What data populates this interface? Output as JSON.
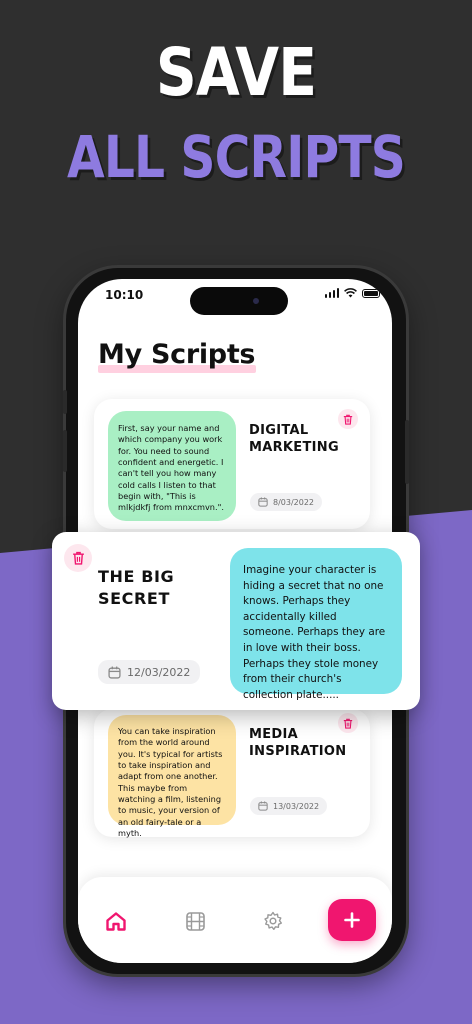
{
  "promo": {
    "line1": "SAVE",
    "line2": "ALL SCRIPTS"
  },
  "status": {
    "time": "10:10"
  },
  "page": {
    "title": "My Scripts"
  },
  "scripts": [
    {
      "title": "DIGITAL MARKETING",
      "date": "8/03/2022",
      "note": "First, say your name and which company you work for. You need to sound confident and energetic. I can't tell you how many cold calls I listen to that begin with, \"This is mlkjdkfj from mnxcmvn.\".",
      "note_color": "#a9efc4"
    },
    {
      "title": "THE BIG SECRET",
      "date": "12/03/2022",
      "note": "Imagine your character is hiding a secret that no one knows. Perhaps they accidentally killed someone. Perhaps they are in love with their boss. Perhaps they stole money from their church's collection plate.....",
      "note_color": "#7ee3ea"
    },
    {
      "title": "MEDIA INSPIRATION",
      "date": "13/03/2022",
      "note": "You can take inspiration from the world around you. It's typical for artists to take inspiration and adapt from one another. This maybe from watching a film, listening to music, your version of an old fairy-tale or a myth.",
      "note_color": "#fde3a4"
    }
  ],
  "tabs": [
    {
      "icon": "home-icon",
      "active": true
    },
    {
      "icon": "film-icon",
      "active": false
    },
    {
      "icon": "gear-icon",
      "active": false
    }
  ],
  "colors": {
    "accent": "#f0166f",
    "purple": "#7d68c6",
    "dark": "#2f2f2f"
  }
}
